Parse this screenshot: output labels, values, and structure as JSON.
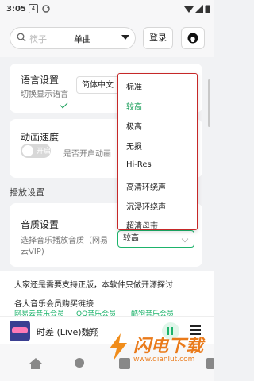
{
  "status_bar": {
    "time": "3:05",
    "badge": "4"
  },
  "top_bar": {
    "search_placeholder": "筷子",
    "search_type": "单曲",
    "login_label": "登录"
  },
  "language_card": {
    "title": "语言设置",
    "subtitle": "切换显示语言",
    "value": "简体中文"
  },
  "animation_card": {
    "title": "动画速度",
    "toggle_label": "开启",
    "subtitle": "是否开启动画"
  },
  "section_playback": "播放设置",
  "quality_card": {
    "title": "音质设置",
    "subtitle_line1": "选择音乐播放音质（网易",
    "subtitle_line2": "云VIP)",
    "value": "较高"
  },
  "quality_options": [
    {
      "label": "标准",
      "selected": false
    },
    {
      "label": "较高",
      "selected": true
    },
    {
      "label": "极高",
      "selected": false
    },
    {
      "label": "无损",
      "selected": false
    },
    {
      "label": "Hi-Res",
      "selected": false
    },
    {
      "label": "高清环绕声",
      "selected": false
    },
    {
      "label": "沉浸环绕声",
      "selected": false
    },
    {
      "label": "超清母带",
      "selected": false
    }
  ],
  "notice": {
    "line1": "大家还是需要支持正版，本软件只做开源探讨",
    "line2": "各大音乐会员购买链接",
    "links": [
      "网易云音乐会员",
      "QQ音乐会员",
      "酷狗音乐会员"
    ]
  },
  "player": {
    "song": "时差 (Live)魏翔"
  },
  "watermark": {
    "title": "闪电下载",
    "url": "www.dianlut.com"
  },
  "colors": {
    "accent": "#1db36b",
    "dropdown_border": "#c62828",
    "selected_option": "#1a9e5a"
  }
}
